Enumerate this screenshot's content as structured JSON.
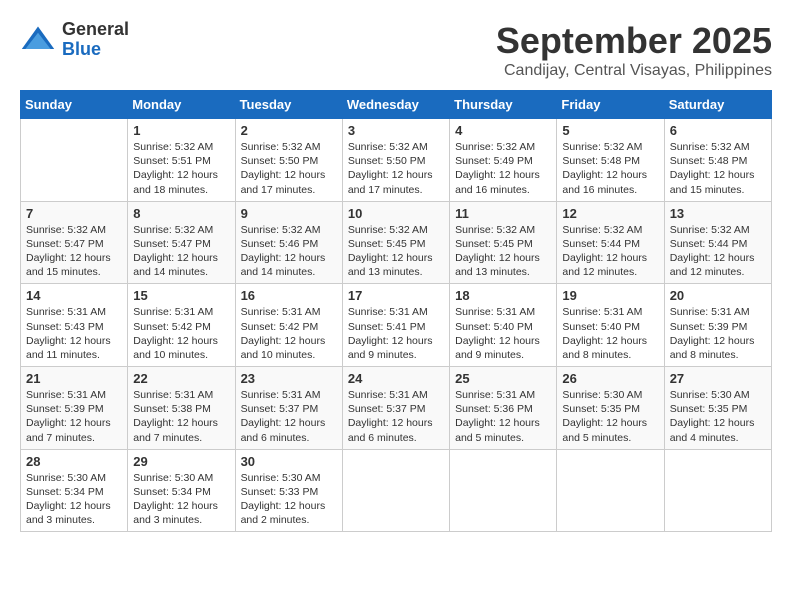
{
  "header": {
    "logo": {
      "general": "General",
      "blue": "Blue"
    },
    "title": "September 2025",
    "subtitle": "Candijay, Central Visayas, Philippines"
  },
  "days_of_week": [
    "Sunday",
    "Monday",
    "Tuesday",
    "Wednesday",
    "Thursday",
    "Friday",
    "Saturday"
  ],
  "weeks": [
    [
      {
        "day": "",
        "info": ""
      },
      {
        "day": "1",
        "info": "Sunrise: 5:32 AM\nSunset: 5:51 PM\nDaylight: 12 hours\nand 18 minutes."
      },
      {
        "day": "2",
        "info": "Sunrise: 5:32 AM\nSunset: 5:50 PM\nDaylight: 12 hours\nand 17 minutes."
      },
      {
        "day": "3",
        "info": "Sunrise: 5:32 AM\nSunset: 5:50 PM\nDaylight: 12 hours\nand 17 minutes."
      },
      {
        "day": "4",
        "info": "Sunrise: 5:32 AM\nSunset: 5:49 PM\nDaylight: 12 hours\nand 16 minutes."
      },
      {
        "day": "5",
        "info": "Sunrise: 5:32 AM\nSunset: 5:48 PM\nDaylight: 12 hours\nand 16 minutes."
      },
      {
        "day": "6",
        "info": "Sunrise: 5:32 AM\nSunset: 5:48 PM\nDaylight: 12 hours\nand 15 minutes."
      }
    ],
    [
      {
        "day": "7",
        "info": "Sunrise: 5:32 AM\nSunset: 5:47 PM\nDaylight: 12 hours\nand 15 minutes."
      },
      {
        "day": "8",
        "info": "Sunrise: 5:32 AM\nSunset: 5:47 PM\nDaylight: 12 hours\nand 14 minutes."
      },
      {
        "day": "9",
        "info": "Sunrise: 5:32 AM\nSunset: 5:46 PM\nDaylight: 12 hours\nand 14 minutes."
      },
      {
        "day": "10",
        "info": "Sunrise: 5:32 AM\nSunset: 5:45 PM\nDaylight: 12 hours\nand 13 minutes."
      },
      {
        "day": "11",
        "info": "Sunrise: 5:32 AM\nSunset: 5:45 PM\nDaylight: 12 hours\nand 13 minutes."
      },
      {
        "day": "12",
        "info": "Sunrise: 5:32 AM\nSunset: 5:44 PM\nDaylight: 12 hours\nand 12 minutes."
      },
      {
        "day": "13",
        "info": "Sunrise: 5:32 AM\nSunset: 5:44 PM\nDaylight: 12 hours\nand 12 minutes."
      }
    ],
    [
      {
        "day": "14",
        "info": "Sunrise: 5:31 AM\nSunset: 5:43 PM\nDaylight: 12 hours\nand 11 minutes."
      },
      {
        "day": "15",
        "info": "Sunrise: 5:31 AM\nSunset: 5:42 PM\nDaylight: 12 hours\nand 10 minutes."
      },
      {
        "day": "16",
        "info": "Sunrise: 5:31 AM\nSunset: 5:42 PM\nDaylight: 12 hours\nand 10 minutes."
      },
      {
        "day": "17",
        "info": "Sunrise: 5:31 AM\nSunset: 5:41 PM\nDaylight: 12 hours\nand 9 minutes."
      },
      {
        "day": "18",
        "info": "Sunrise: 5:31 AM\nSunset: 5:40 PM\nDaylight: 12 hours\nand 9 minutes."
      },
      {
        "day": "19",
        "info": "Sunrise: 5:31 AM\nSunset: 5:40 PM\nDaylight: 12 hours\nand 8 minutes."
      },
      {
        "day": "20",
        "info": "Sunrise: 5:31 AM\nSunset: 5:39 PM\nDaylight: 12 hours\nand 8 minutes."
      }
    ],
    [
      {
        "day": "21",
        "info": "Sunrise: 5:31 AM\nSunset: 5:39 PM\nDaylight: 12 hours\nand 7 minutes."
      },
      {
        "day": "22",
        "info": "Sunrise: 5:31 AM\nSunset: 5:38 PM\nDaylight: 12 hours\nand 7 minutes."
      },
      {
        "day": "23",
        "info": "Sunrise: 5:31 AM\nSunset: 5:37 PM\nDaylight: 12 hours\nand 6 minutes."
      },
      {
        "day": "24",
        "info": "Sunrise: 5:31 AM\nSunset: 5:37 PM\nDaylight: 12 hours\nand 6 minutes."
      },
      {
        "day": "25",
        "info": "Sunrise: 5:31 AM\nSunset: 5:36 PM\nDaylight: 12 hours\nand 5 minutes."
      },
      {
        "day": "26",
        "info": "Sunrise: 5:30 AM\nSunset: 5:35 PM\nDaylight: 12 hours\nand 5 minutes."
      },
      {
        "day": "27",
        "info": "Sunrise: 5:30 AM\nSunset: 5:35 PM\nDaylight: 12 hours\nand 4 minutes."
      }
    ],
    [
      {
        "day": "28",
        "info": "Sunrise: 5:30 AM\nSunset: 5:34 PM\nDaylight: 12 hours\nand 3 minutes."
      },
      {
        "day": "29",
        "info": "Sunrise: 5:30 AM\nSunset: 5:34 PM\nDaylight: 12 hours\nand 3 minutes."
      },
      {
        "day": "30",
        "info": "Sunrise: 5:30 AM\nSunset: 5:33 PM\nDaylight: 12 hours\nand 2 minutes."
      },
      {
        "day": "",
        "info": ""
      },
      {
        "day": "",
        "info": ""
      },
      {
        "day": "",
        "info": ""
      },
      {
        "day": "",
        "info": ""
      }
    ]
  ]
}
